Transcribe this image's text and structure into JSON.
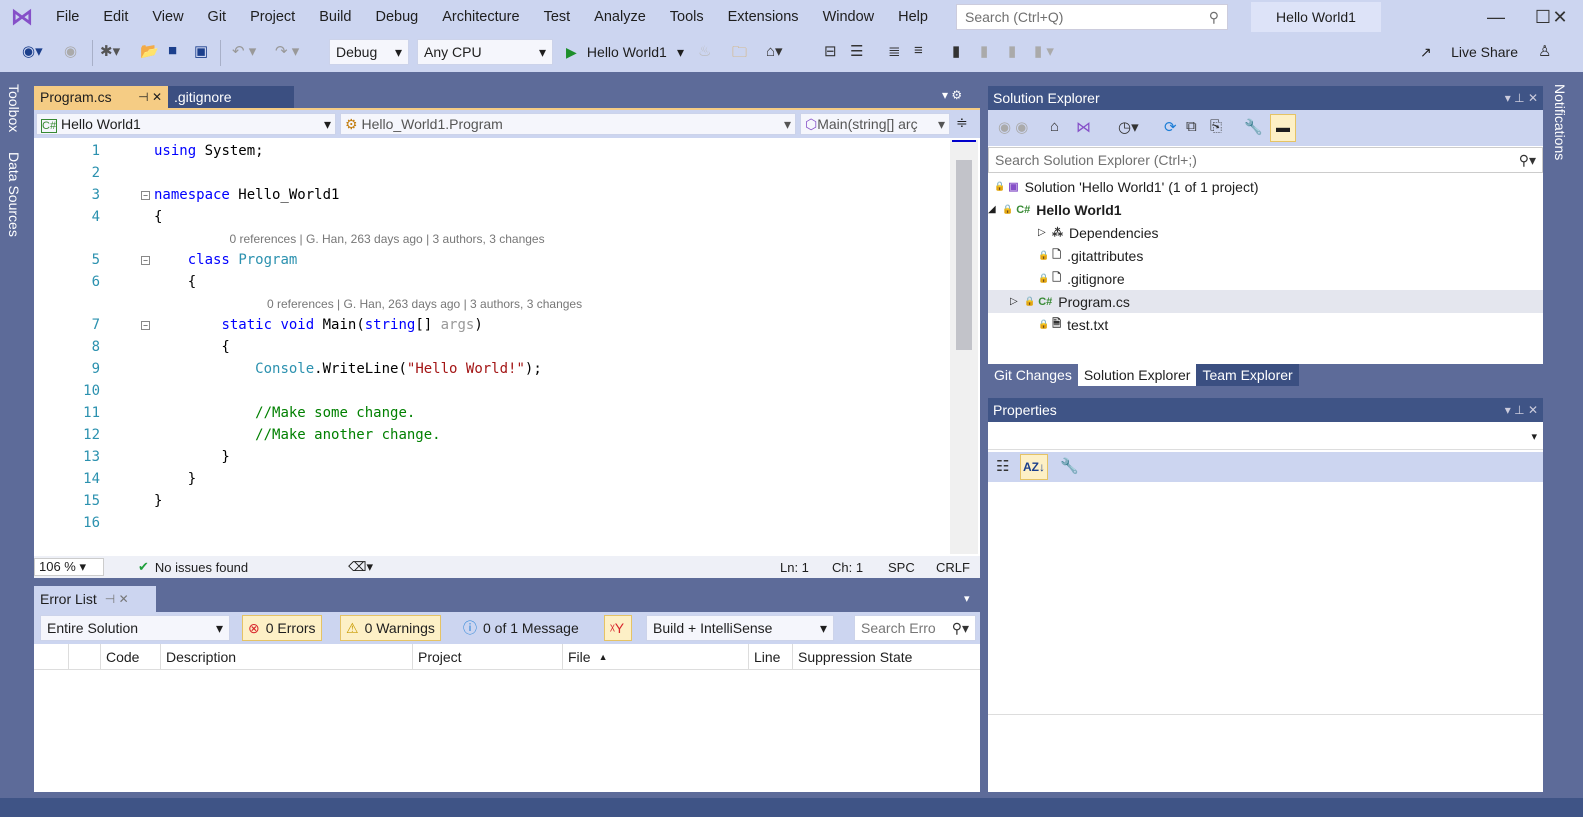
{
  "menu": [
    "File",
    "Edit",
    "View",
    "Git",
    "Project",
    "Build",
    "Debug",
    "Architecture",
    "Test",
    "Analyze",
    "Tools",
    "Extensions",
    "Window",
    "Help"
  ],
  "search": {
    "placeholder": "Search (Ctrl+Q)"
  },
  "window_title": "Hello World1",
  "toolbar": {
    "config": "Debug",
    "platform": "Any CPU",
    "run": "Hello World1",
    "live_share": "Live Share"
  },
  "side": {
    "toolbox": "Toolbox",
    "data_sources": "Data Sources",
    "notifications": "Notifications"
  },
  "tabs": [
    {
      "label": "Program.cs",
      "active": true
    },
    {
      "label": ".gitignore",
      "active": false
    }
  ],
  "nav": {
    "project": "Hello World1",
    "class": "Hello_World1.Program",
    "member": "Main(string[] args)",
    "member_short": "Main(string[] arç"
  },
  "code": [
    {
      "n": "1",
      "tok": [
        {
          "t": "using",
          "c": "kw"
        },
        {
          "t": " System;",
          "c": "pl"
        }
      ]
    },
    {
      "n": "2",
      "tok": []
    },
    {
      "n": "3",
      "fold": true,
      "tok": [
        {
          "t": "namespace",
          "c": "kw"
        },
        {
          "t": " Hello_World1",
          "c": "pl"
        }
      ]
    },
    {
      "n": "4",
      "tok": [
        {
          "t": "{",
          "c": "pl"
        }
      ]
    },
    {
      "lens": "0 references | G. Han, 263 days ago | 3 authors, 3 changes",
      "indent": 1
    },
    {
      "n": "5",
      "fold": true,
      "tok": [
        {
          "t": "    ",
          "c": "pl"
        },
        {
          "t": "class",
          "c": "kw"
        },
        {
          "t": " ",
          "c": "pl"
        },
        {
          "t": "Program",
          "c": "ty"
        }
      ]
    },
    {
      "n": "6",
      "tok": [
        {
          "t": "    {",
          "c": "pl"
        }
      ]
    },
    {
      "lens": "0 references | G. Han, 263 days ago | 3 authors, 3 changes",
      "indent": 2
    },
    {
      "n": "7",
      "fold": true,
      "tok": [
        {
          "t": "        ",
          "c": "pl"
        },
        {
          "t": "static",
          "c": "kw"
        },
        {
          "t": " ",
          "c": "pl"
        },
        {
          "t": "void",
          "c": "kw"
        },
        {
          "t": " Main(",
          "c": "pl"
        },
        {
          "t": "string",
          "c": "kw"
        },
        {
          "t": "[] ",
          "c": "pl"
        },
        {
          "t": "args",
          "c": "pa"
        },
        {
          "t": ")",
          "c": "pl"
        }
      ]
    },
    {
      "n": "8",
      "tok": [
        {
          "t": "        {",
          "c": "pl"
        }
      ]
    },
    {
      "n": "9",
      "tok": [
        {
          "t": "            ",
          "c": "pl"
        },
        {
          "t": "Console",
          "c": "ty"
        },
        {
          "t": ".WriteLine(",
          "c": "pl"
        },
        {
          "t": "\"Hello World!\"",
          "c": "st"
        },
        {
          "t": ");",
          "c": "pl"
        }
      ]
    },
    {
      "n": "10",
      "tok": []
    },
    {
      "n": "11",
      "tok": [
        {
          "t": "            ",
          "c": "pl"
        },
        {
          "t": "//Make some change.",
          "c": "cm"
        }
      ]
    },
    {
      "n": "12",
      "tok": [
        {
          "t": "            ",
          "c": "pl"
        },
        {
          "t": "//Make another change.",
          "c": "cm"
        }
      ]
    },
    {
      "n": "13",
      "tok": [
        {
          "t": "        }",
          "c": "pl"
        }
      ]
    },
    {
      "n": "14",
      "tok": [
        {
          "t": "    }",
          "c": "pl"
        }
      ]
    },
    {
      "n": "15",
      "tok": [
        {
          "t": "}",
          "c": "pl"
        }
      ]
    },
    {
      "n": "16",
      "tok": []
    }
  ],
  "status": {
    "zoom": "106 %",
    "issues": "No issues found",
    "ln": "Ln: 1",
    "ch": "Ch: 1",
    "spc": "SPC",
    "crlf": "CRLF"
  },
  "errors": {
    "title": "Error List",
    "scope": "Entire Solution",
    "errors": "0 Errors",
    "warnings": "0 Warnings",
    "messages": "0 of 1 Message",
    "build": "Build + IntelliSense",
    "search_placeholder": "Search Erro",
    "columns": [
      "Code",
      "Description",
      "Project",
      "File",
      "Line",
      "Suppression State"
    ]
  },
  "solution_explorer": {
    "title": "Solution Explorer",
    "search_placeholder": "Search Solution Explorer (Ctrl+;)",
    "items": [
      {
        "label": "Solution 'Hello World1' (1 of 1 project)",
        "icon": "solution-icon"
      },
      {
        "label": "Hello World1",
        "icon": "csharp-project-icon"
      },
      {
        "label": "Dependencies",
        "icon": "dependencies-icon"
      },
      {
        "label": ".gitattributes",
        "icon": "file-icon"
      },
      {
        "label": ".gitignore",
        "icon": "file-icon"
      },
      {
        "label": "Program.cs",
        "icon": "csharp-file-icon"
      },
      {
        "label": "test.txt",
        "icon": "text-file-icon"
      }
    ],
    "tabs": [
      "Git Changes",
      "Solution Explorer",
      "Team Explorer"
    ]
  },
  "properties": {
    "title": "Properties"
  }
}
